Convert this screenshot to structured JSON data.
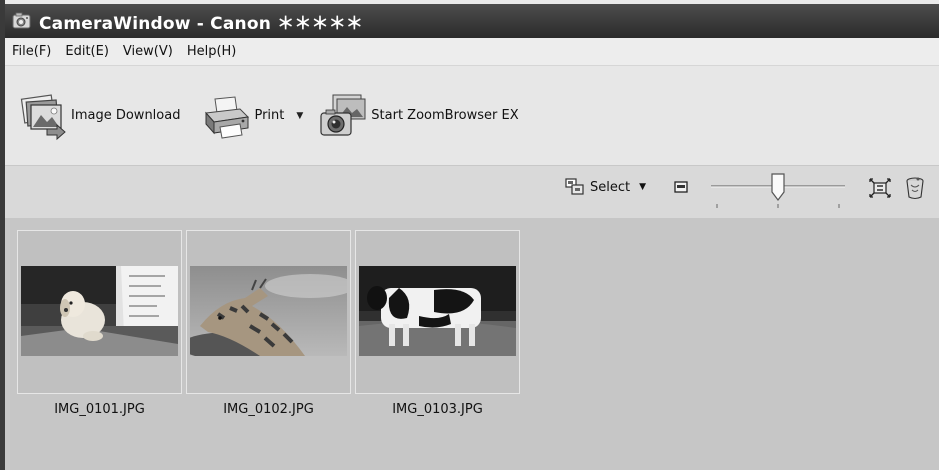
{
  "window": {
    "title": "CameraWindow - Canon ＊＊＊＊＊",
    "app_icon": "camera-window-app-icon"
  },
  "menu": {
    "items": [
      {
        "label": "File(F)"
      },
      {
        "label": "Edit(E)"
      },
      {
        "label": "View(V)"
      },
      {
        "label": "Help(H)"
      }
    ]
  },
  "toolbar": {
    "image_download": {
      "label": "Image Download",
      "icon": "image-download-icon"
    },
    "print": {
      "label": "Print",
      "icon": "printer-icon",
      "dropdown": "▼"
    },
    "zoombrowser": {
      "label": "Start ZoomBrowser EX",
      "icon": "zoombrowser-icon"
    }
  },
  "viewbar": {
    "select": {
      "label": "Select",
      "dropdown": "▼",
      "icon": "select-icon"
    },
    "zoom_slider": {
      "value_fraction": 0.5,
      "ticks": 3
    },
    "icons": [
      "small-thumbnail-icon",
      "fit-screen-icon",
      "trash-icon"
    ]
  },
  "thumbnails": [
    {
      "filename": "IMG_0101.JPG",
      "subject": "puppy-photo"
    },
    {
      "filename": "IMG_0102.JPG",
      "subject": "giraffe-photo"
    },
    {
      "filename": "IMG_0103.JPG",
      "subject": "cow-photo"
    }
  ]
}
